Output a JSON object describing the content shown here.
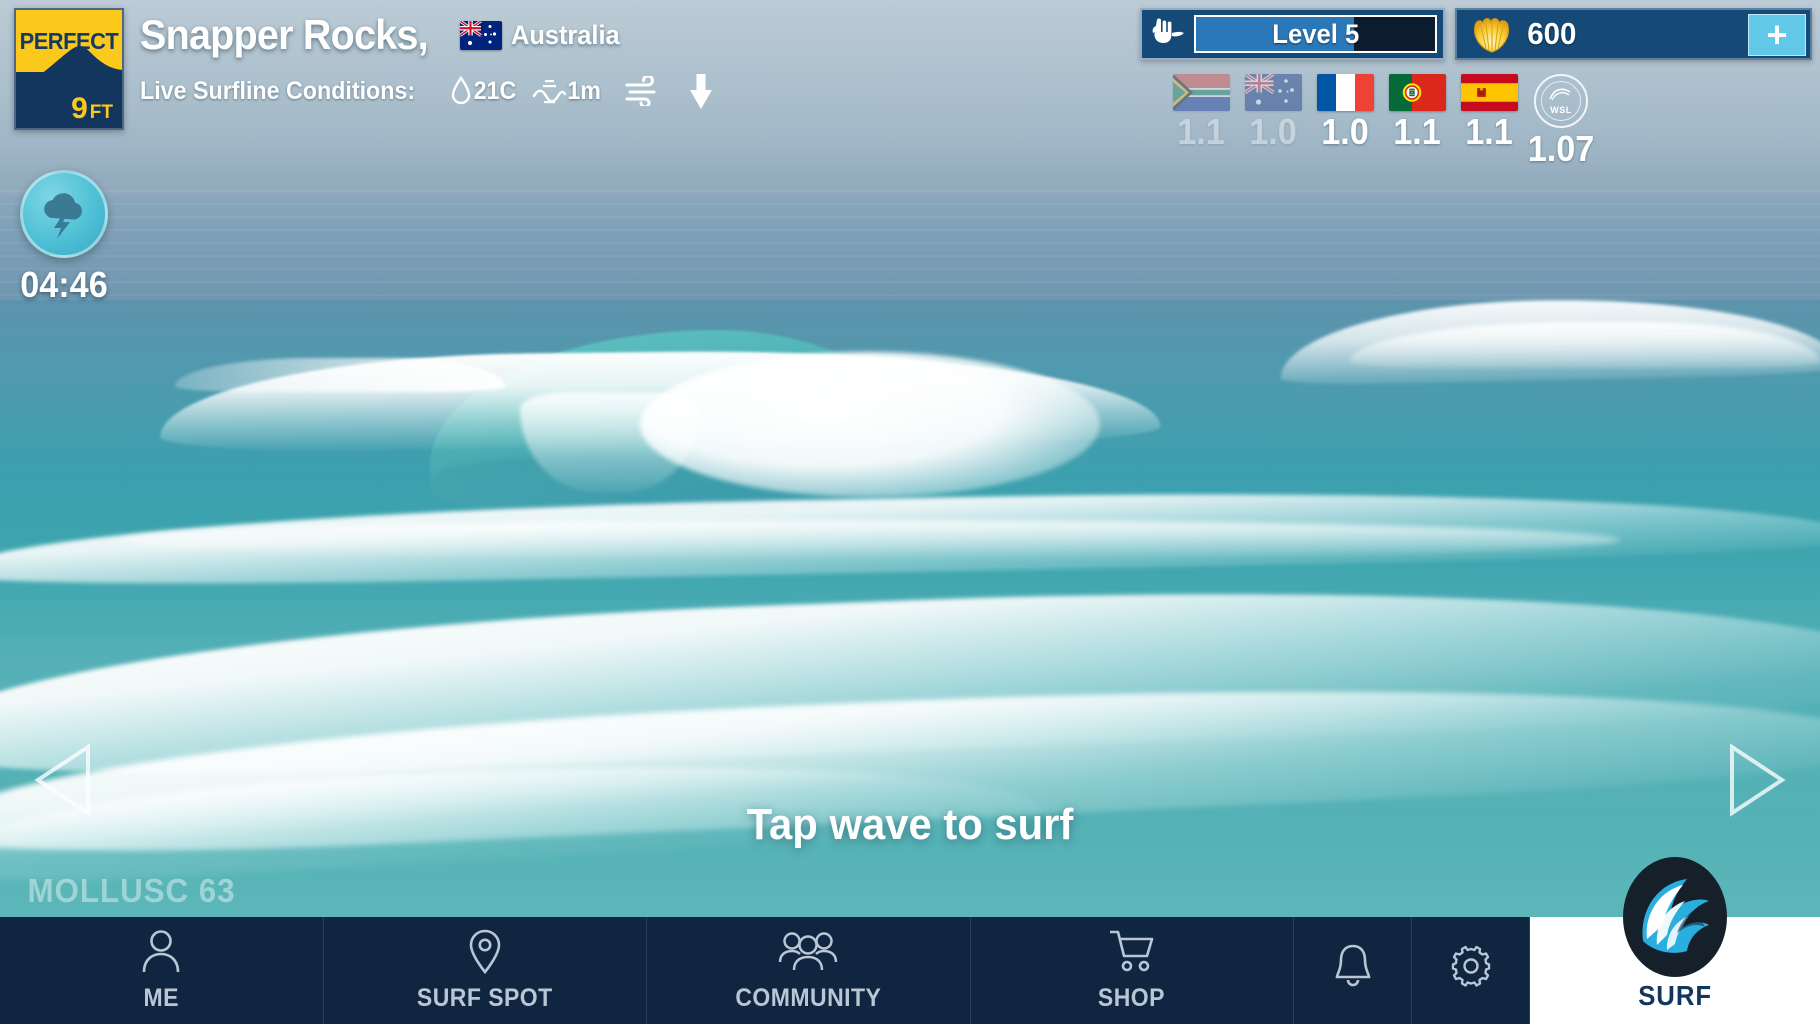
{
  "header": {
    "badge": {
      "condition": "PERFECT",
      "height_value": "9",
      "height_unit": "FT"
    },
    "spot_name": "Snapper Rocks,",
    "country": "Australia",
    "country_flag": "australia-flag",
    "conditions_label": "Live Surfline Conditions:",
    "water_temp": "21C",
    "swell_height": "1m",
    "water_icon": "water-drop-icon",
    "swell_icon": "swell-wave-icon",
    "wind_icon": "wind-icon",
    "wind_direction_icon": "arrow-down-icon"
  },
  "hud": {
    "level_icon": "shaka-hand-icon",
    "level_label": "Level",
    "level_value": "5",
    "level_progress_percent": 66,
    "currency_icon": "shell-coin-icon",
    "currency_amount": "600",
    "add_currency_label": "+",
    "accent_blue": "#2a78b8",
    "panel_blue": "#154a78",
    "plus_cyan": "#62c8e8"
  },
  "ratings": [
    {
      "flag": "south-africa-flag",
      "score": "1.1",
      "dimmed": true
    },
    {
      "flag": "australia-flag",
      "score": "1.0",
      "dimmed": true
    },
    {
      "flag": "france-flag",
      "score": "1.0",
      "dimmed": false
    },
    {
      "flag": "portugal-flag",
      "score": "1.1",
      "dimmed": false
    },
    {
      "flag": "spain-flag",
      "score": "1.1",
      "dimmed": false
    },
    {
      "flag": "wsl-badge",
      "score": "1.07",
      "dimmed": false,
      "badge_text": "WSL"
    }
  ],
  "storm": {
    "icon": "storm-cloud-lightning-icon",
    "timer": "04:46"
  },
  "scene": {
    "tap_prompt": "Tap wave to surf",
    "prev_label": "previous-wave-arrow",
    "next_label": "next-wave-arrow",
    "watermark": "MOLLUSC 63"
  },
  "navbar": {
    "items": [
      {
        "label": "ME",
        "icon": "person-icon"
      },
      {
        "label": "SURF SPOT",
        "icon": "map-pin-icon"
      },
      {
        "label": "COMMUNITY",
        "icon": "people-group-icon"
      },
      {
        "label": "SHOP",
        "icon": "shopping-cart-icon"
      },
      {
        "label": "",
        "icon": "bell-icon"
      },
      {
        "label": "",
        "icon": "gear-icon"
      }
    ],
    "surf_button": {
      "label": "SURF",
      "icon": "wave-logo-icon"
    }
  }
}
